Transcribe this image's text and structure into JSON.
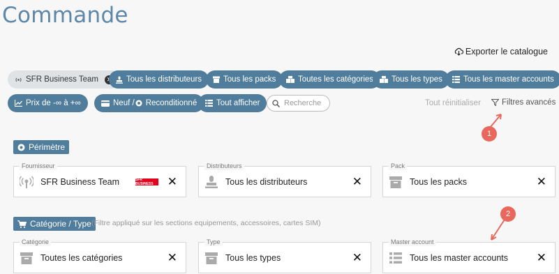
{
  "page": {
    "title": "Commande"
  },
  "toolbar": {
    "export_label": "Exporter le catalogue"
  },
  "filters": {
    "supplier_chip": "SFR Business Team",
    "distributors": "Tous les distributeurs",
    "packs": "Tous les packs",
    "categories": "Toutes les catégories",
    "types": "Tous les types",
    "master_accounts": "Tous les master accounts",
    "price": "Prix de -∞ à +∞",
    "condition": "Neuf / ",
    "condition2": "Reconditionné",
    "show_all": "Tout afficher",
    "search_placeholder": "Recherche",
    "reset": "Tout réinitialiser",
    "advanced": "Filtres avancés"
  },
  "annotations": {
    "badge1": "1",
    "badge2": "2"
  },
  "perimetre": {
    "title": "Périmètre",
    "cards": [
      {
        "label": "Fournisseur",
        "value": "SFR Business Team",
        "logo": "SFR BUSINESS"
      },
      {
        "label": "Distributeurs",
        "value": "Tous les distributeurs"
      },
      {
        "label": "Pack",
        "value": "Tous les packs"
      }
    ]
  },
  "categorie": {
    "title": "Catégorie / Type",
    "note": "(Filtre appliqué sur les sections equipements, accessoires, cartes SIM)",
    "cards": [
      {
        "label": "Catégorie",
        "value": "Toutes les catégories"
      },
      {
        "label": "Type",
        "value": "Tous les types"
      },
      {
        "label": "Master account",
        "value": "Tous les master accounts"
      }
    ]
  },
  "colors": {
    "accent": "#4f7d9b",
    "title": "#5d87a8",
    "badge": "#e8685d"
  },
  "close_glyph": "✕"
}
